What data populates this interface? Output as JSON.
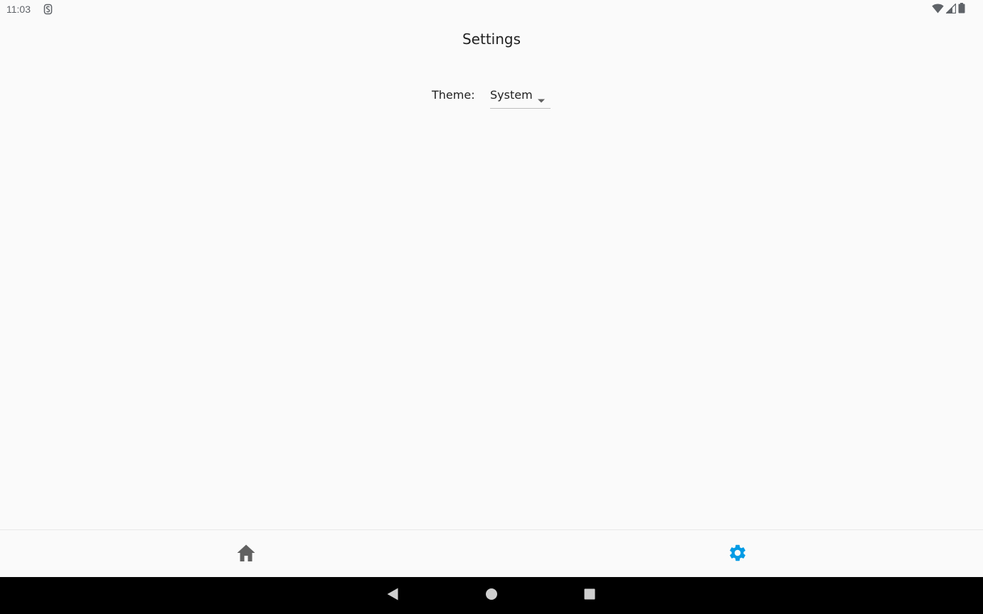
{
  "status_bar": {
    "time": "11:03",
    "app_icon": "s-notification-icon",
    "icons": [
      "wifi-icon",
      "cell-signal-icon",
      "battery-icon"
    ]
  },
  "page": {
    "title": "Settings"
  },
  "theme_setting": {
    "label": "Theme:",
    "selected": "System"
  },
  "bottom_nav": {
    "items": [
      {
        "icon": "home-icon",
        "active": false
      },
      {
        "icon": "gear-icon",
        "active": true
      }
    ]
  },
  "system_nav": {
    "items": [
      "back-icon",
      "home-circle-icon",
      "recents-icon"
    ]
  },
  "colors": {
    "accent": "#039be5",
    "inactive_icon": "#5f6368",
    "background": "#fafafa",
    "text": "#212121"
  }
}
